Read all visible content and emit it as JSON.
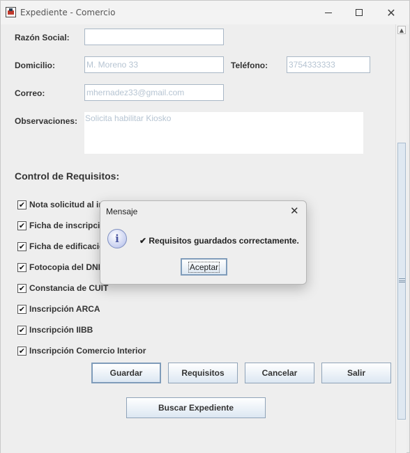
{
  "window": {
    "title": "Expediente - Comercio",
    "minimize_glyph": "",
    "close_glyph": "✕"
  },
  "form": {
    "razon_social": {
      "label": "Razón Social:",
      "value": ""
    },
    "domicilio": {
      "label": "Domicilio:",
      "value": "M. Moreno 33"
    },
    "telefono": {
      "label": "Teléfono:",
      "value": "3754333333"
    },
    "correo": {
      "label": "Correo:",
      "value": "mhernadez33@gmail.com"
    },
    "observaciones": {
      "label": "Observaciones:",
      "value": "Solicita habilitar Kiosko"
    }
  },
  "requisitos": {
    "title": "Control de Requisitos:",
    "items": [
      {
        "label": "Nota solicitud al in",
        "checked": true
      },
      {
        "label": "Ficha de inscripció",
        "checked": true
      },
      {
        "label": "Ficha de edificació",
        "checked": true
      },
      {
        "label": "Fotocopia del DNI",
        "checked": true
      },
      {
        "label": "Constancia de CUIT",
        "checked": true
      },
      {
        "label": "Inscripción ARCA",
        "checked": true
      },
      {
        "label": "Inscripción IIBB",
        "checked": true
      },
      {
        "label": "Inscripción Comercio Interior",
        "checked": true
      }
    ],
    "check_glyph": "✔"
  },
  "buttons": {
    "guardar": "Guardar",
    "requisitos": "Requisitos",
    "cancelar": "Cancelar",
    "salir": "Salir",
    "buscar": "Buscar Expediente"
  },
  "dialog": {
    "title": "Mensaje",
    "close_glyph": "✕",
    "icon": "info-icon",
    "icon_glyph": "i",
    "message": "✔ Requisitos guardados correctamente.",
    "ok": "Aceptar"
  },
  "colors": {
    "accent_border": "#7f9cba",
    "field_text": "#b6c4d2"
  }
}
